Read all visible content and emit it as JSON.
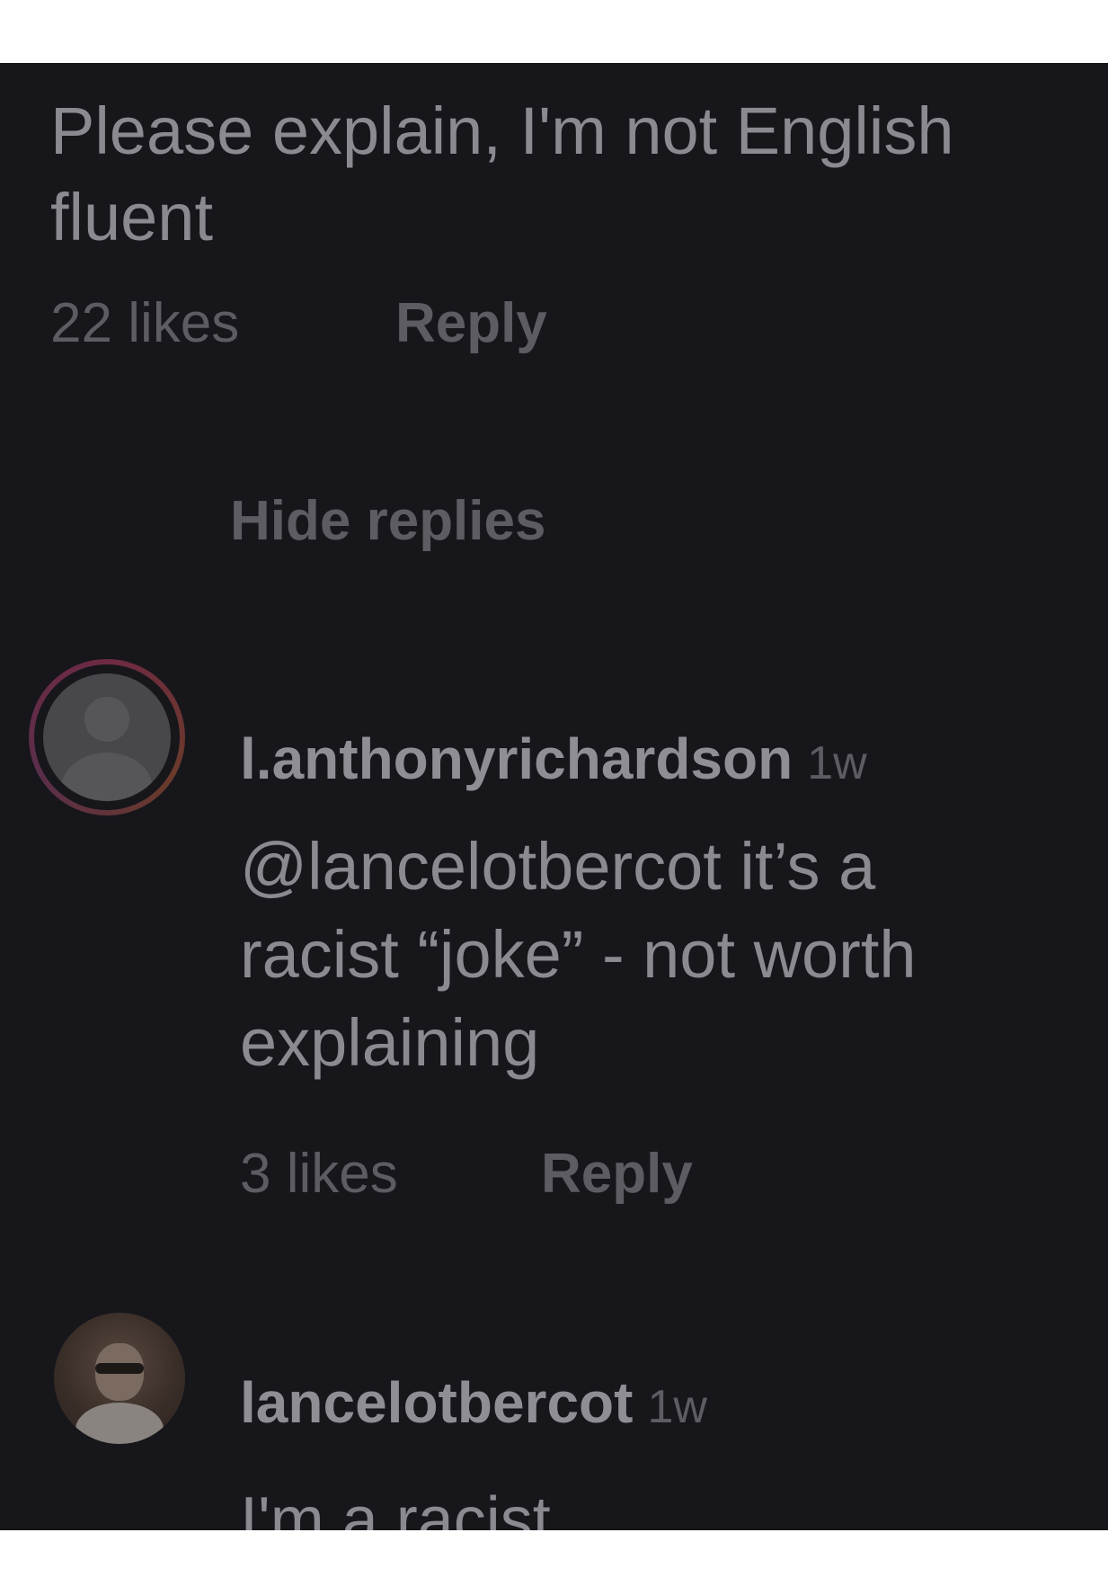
{
  "comments": [
    {
      "text_lines": [
        "Please explain, I'm not English",
        "fluent"
      ],
      "likes": "22 likes",
      "reply_label": "Reply"
    }
  ],
  "thread": {
    "hide_replies_label": "Hide replies"
  },
  "replies": [
    {
      "username": "l.anthonyrichardson",
      "time": "1w",
      "text_lines": [
        "@lancelotbercot it’s a",
        "racist “joke” - not worth",
        "explaining"
      ],
      "likes": "3 likes",
      "reply_label": "Reply"
    },
    {
      "username": "lancelotbercot",
      "time": "1w",
      "text_lines": [
        "I'm a racist"
      ]
    }
  ],
  "icons": {
    "avatar_1": "default-avatar-icon",
    "avatar_2": "profile-photo-avatar"
  },
  "colors": {
    "background": "#16161b",
    "primary_text": "#8a8a90",
    "secondary_text": "#5c5c62"
  }
}
